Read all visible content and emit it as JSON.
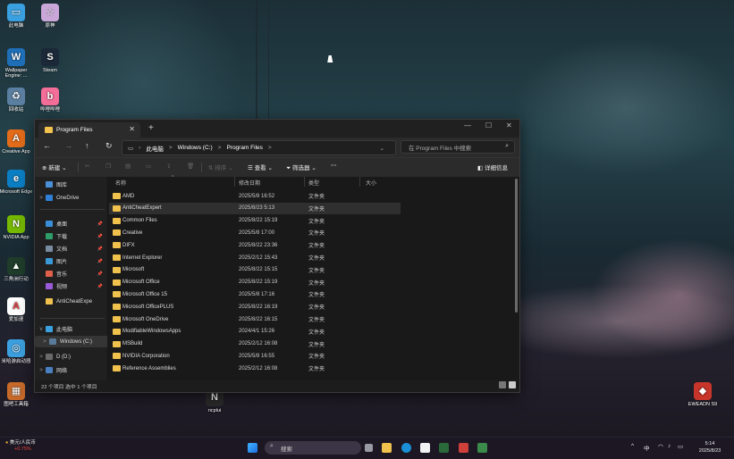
{
  "desktop": {
    "icons": [
      {
        "label": "此电脑",
        "color": "#3aa0e0",
        "glyph": "▭"
      },
      {
        "label": "原神",
        "color": "#c9a7d8",
        "glyph": "☆"
      },
      {
        "label": "Wallpaper Engine: ...",
        "color": "#1f6fb8",
        "glyph": "W"
      },
      {
        "label": "Steam",
        "color": "#1b2838",
        "glyph": "S"
      },
      {
        "label": "回收站",
        "color": "#5b7fa0",
        "glyph": "♻"
      },
      {
        "label": "哔哩哔哩",
        "color": "#f36e98",
        "glyph": "b"
      },
      {
        "label": "Creative App",
        "color": "#e36c1a",
        "glyph": "A"
      },
      {
        "label": "Microsoft Edge",
        "color": "#0c7fc4",
        "glyph": "e"
      },
      {
        "label": "NVIDIA App",
        "color": "#76b900",
        "glyph": "N"
      },
      {
        "label": "三角洲行动",
        "color": "#1f3d2a",
        "glyph": "▲"
      },
      {
        "label": "爱加速",
        "color": "#ffffff",
        "glyph": "A"
      },
      {
        "label": "米哈游启动器",
        "color": "#3ca0e0",
        "glyph": "◎"
      },
      {
        "label": "图吧工具箱",
        "color": "#c86a2a",
        "glyph": "▦"
      },
      {
        "label": "ncplui",
        "color": "#2b2b2b",
        "glyph": "N"
      },
      {
        "label": "EWEADN S9",
        "color": "#c8352a",
        "glyph": "◆"
      }
    ]
  },
  "explorer": {
    "tab_title": "Program Files",
    "new_tab": "+",
    "address": [
      "此电脑",
      ">",
      "Windows (C:)",
      ">",
      "Program Files",
      ">"
    ],
    "search_placeholder": "在 Program Files 中搜索",
    "toolbar": {
      "new": "新建",
      "sort": "排序",
      "view": "查看",
      "filter": "筛选器",
      "more": "···",
      "details": "详细信息"
    },
    "nav": [
      {
        "label": "图库",
        "color": "#4a90d9",
        "chev": "",
        "pin": false
      },
      {
        "label": "OneDrive",
        "color": "#2f7fd6",
        "chev": ">",
        "pin": false
      },
      {
        "label": "桌面",
        "color": "#3a8ed8",
        "chev": "",
        "pin": true
      },
      {
        "label": "下载",
        "color": "#2f9d6a",
        "chev": "",
        "pin": true
      },
      {
        "label": "文档",
        "color": "#7a8ca0",
        "chev": "",
        "pin": true
      },
      {
        "label": "图片",
        "color": "#3a9ad8",
        "chev": "",
        "pin": true
      },
      {
        "label": "音乐",
        "color": "#e0604a",
        "chev": "",
        "pin": true
      },
      {
        "label": "视频",
        "color": "#9a5ad8",
        "chev": "",
        "pin": true
      },
      {
        "label": "AntiCheatExpe",
        "color": "#f0c24d",
        "chev": "",
        "pin": false
      },
      {
        "label": "此电脑",
        "color": "#3aa0e0",
        "chev": "v",
        "pin": false
      },
      {
        "label": "Windows (C:)",
        "color": "#5a7a9a",
        "chev": ">",
        "pin": false
      },
      {
        "label": "D (D:)",
        "color": "#6a6a6a",
        "chev": ">",
        "pin": false
      },
      {
        "label": "网络",
        "color": "#4a80c0",
        "chev": ">",
        "pin": false
      }
    ],
    "columns": [
      "名称",
      "修改日期",
      "类型",
      "大小"
    ],
    "rows": [
      {
        "name": "AMD",
        "date": "2025/5/8 16:52",
        "type": "文件夹"
      },
      {
        "name": "AntiCheatExpert",
        "date": "2025/8/23 5:13",
        "type": "文件夹"
      },
      {
        "name": "Common Files",
        "date": "2025/8/22 15:19",
        "type": "文件夹"
      },
      {
        "name": "Creative",
        "date": "2025/5/8 17:00",
        "type": "文件夹"
      },
      {
        "name": "DIFX",
        "date": "2025/8/22 23:36",
        "type": "文件夹"
      },
      {
        "name": "Internet Explorer",
        "date": "2025/2/12 15:43",
        "type": "文件夹"
      },
      {
        "name": "Microsoft",
        "date": "2025/8/22 15:15",
        "type": "文件夹"
      },
      {
        "name": "Microsoft Office",
        "date": "2025/8/22 15:19",
        "type": "文件夹"
      },
      {
        "name": "Microsoft Office 15",
        "date": "2025/5/8 17:16",
        "type": "文件夹"
      },
      {
        "name": "Microsoft OfficePLUS",
        "date": "2025/8/22 16:19",
        "type": "文件夹"
      },
      {
        "name": "Microsoft OneDrive",
        "date": "2025/8/22 16:15",
        "type": "文件夹"
      },
      {
        "name": "ModifiableWindowsApps",
        "date": "2024/4/1 15:26",
        "type": "文件夹"
      },
      {
        "name": "MSBuild",
        "date": "2025/2/12 16:08",
        "type": "文件夹"
      },
      {
        "name": "NVIDIA Corporation",
        "date": "2025/5/8 16:55",
        "type": "文件夹"
      },
      {
        "name": "Reference Assemblies",
        "date": "2025/2/12 16:08",
        "type": "文件夹"
      }
    ],
    "selected_row": 1,
    "status": "22 个项目   选中 1 个项目"
  },
  "taskbar": {
    "weather_temp": "美元/人民币",
    "weather_change": "+0.75%",
    "search_label": "搜索",
    "tray_lang": "中",
    "time": "5:14",
    "date": "2025/8/23"
  }
}
